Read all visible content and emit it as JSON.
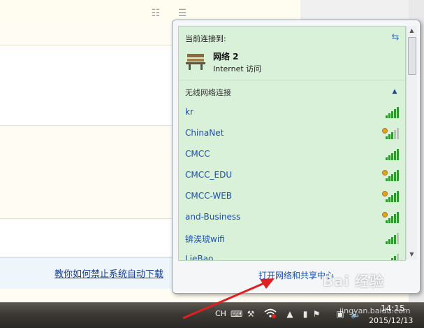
{
  "background": {
    "link_text": "教你如何禁止系统自动下载"
  },
  "flyout": {
    "current_label": "当前连接到:",
    "network_name": "网络  2",
    "network_access": "Internet 访问",
    "wireless_header": "无线网络连接",
    "networks": [
      {
        "name": "kr",
        "secured": false,
        "bars": 5
      },
      {
        "name": "ChinaNet",
        "secured": true,
        "bars": 3
      },
      {
        "name": "CMCC",
        "secured": false,
        "bars": 5
      },
      {
        "name": "CMCC_EDU",
        "secured": true,
        "bars": 5
      },
      {
        "name": "CMCC-WEB",
        "secured": true,
        "bars": 5
      },
      {
        "name": "and-Business",
        "secured": true,
        "bars": 5
      },
      {
        "name": "锛涘琥wifi",
        "secured": false,
        "bars": 4
      },
      {
        "name": "LieBao",
        "secured": false,
        "bars": 4
      }
    ],
    "footer_link": "打开网络和共享中心"
  },
  "taskbar": {
    "lang": "CH",
    "time": "14:15",
    "date": "2015/12/13"
  },
  "watermark": {
    "logo": "Bai 经验",
    "url": "jingyan.baidu.com"
  },
  "colors": {
    "flyout_green": "#d9f0d9",
    "link_blue": "#1a4fb0",
    "signal_green": "#2e9a2e",
    "arrow_red": "#e02020"
  }
}
